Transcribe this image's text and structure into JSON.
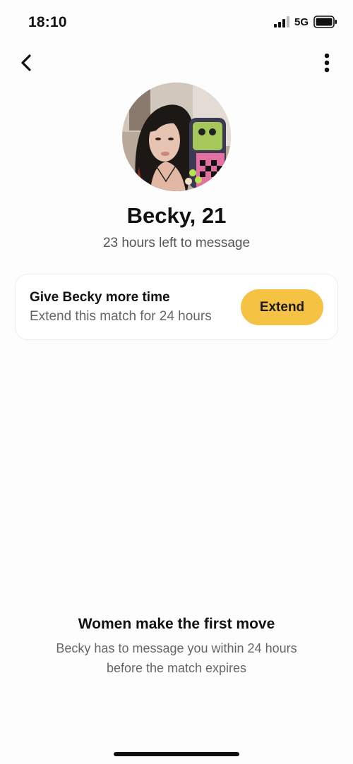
{
  "status_bar": {
    "time": "18:10",
    "network": "5G",
    "icons": [
      "signal-icon",
      "battery-icon"
    ]
  },
  "nav": {
    "back_icon": "chevron-left-icon",
    "more_icon": "more-vertical-icon"
  },
  "profile": {
    "name_age": "Becky, 21",
    "time_left": "23 hours left to message"
  },
  "extend_card": {
    "title": "Give Becky more time",
    "subtitle": "Extend this match for 24 hours",
    "button_label": "Extend",
    "button_color": "#f5c244"
  },
  "info": {
    "title": "Women make the first move",
    "line1": "Becky has to message you within 24 hours",
    "line2": "before the match expires"
  }
}
